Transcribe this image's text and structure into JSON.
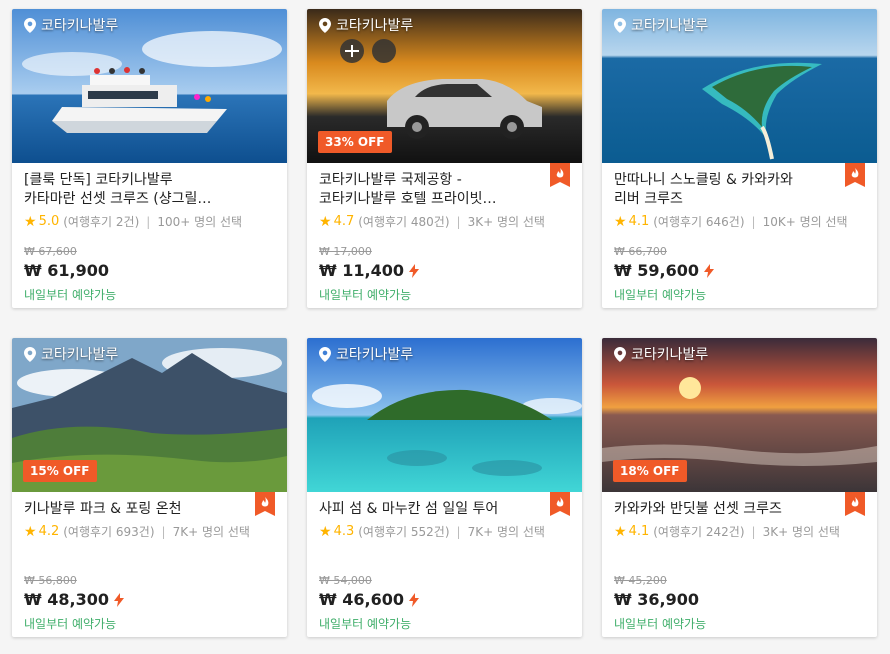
{
  "colors": {
    "discount": "#f05a28",
    "star": "#ffb400",
    "availability": "#3fae6a",
    "hot_badge": "#f05a28"
  },
  "icons": {
    "location": "map-pin-icon",
    "hot": "flame-icon",
    "instant": "lightning-icon",
    "rating": "star-icon"
  },
  "cards": [
    {
      "location": "코타키나발루",
      "title_line1": "[클룩 단독] 코타키나발루",
      "title_line2": "카타마란 선셋 크루즈 (샹그릴…",
      "rating": "5.0",
      "reviews": "(여행후기 2건)",
      "chosen": "100+ 명의 선택",
      "original_price": "₩ 67,600",
      "price": "₩ 61,900",
      "availability": "내일부터 예약가능",
      "discount": "",
      "hot": false,
      "instant": false
    },
    {
      "location": "코타키나발루",
      "title_line1": "코타키나발루 국제공항 -",
      "title_line2": "코타키나발루 호텔 프라이빗…",
      "rating": "4.7",
      "reviews": "(여행후기 480건)",
      "chosen": "3K+ 명의 선택",
      "original_price": "₩ 17,000",
      "price": "₩ 11,400",
      "availability": "내일부터 예약가능",
      "discount": "33% OFF",
      "hot": true,
      "instant": true
    },
    {
      "location": "코타키나발루",
      "title_line1": "만따나니 스노클링 & 카와카와",
      "title_line2": "리버 크루즈",
      "rating": "4.1",
      "reviews": "(여행후기 646건)",
      "chosen": "10K+ 명의 선택",
      "original_price": "₩ 66,700",
      "price": "₩ 59,600",
      "availability": "내일부터 예약가능",
      "discount": "",
      "hot": true,
      "instant": true
    },
    {
      "location": "코타키나발루",
      "title_line1": "키나발루 파크 & 포링 온천",
      "title_line2": "",
      "rating": "4.2",
      "reviews": "(여행후기 693건)",
      "chosen": "7K+ 명의 선택",
      "original_price": "₩ 56,800",
      "price": "₩ 48,300",
      "availability": "내일부터 예약가능",
      "discount": "15% OFF",
      "hot": true,
      "instant": true
    },
    {
      "location": "코타키나발루",
      "title_line1": "사피 섬 & 마누칸 섬 일일 투어",
      "title_line2": "",
      "rating": "4.3",
      "reviews": "(여행후기 552건)",
      "chosen": "7K+ 명의 선택",
      "original_price": "₩ 54,000",
      "price": "₩ 46,600",
      "availability": "내일부터 예약가능",
      "discount": "",
      "hot": true,
      "instant": true
    },
    {
      "location": "코타키나발루",
      "title_line1": "카와카와 반딧불 선셋 크루즈",
      "title_line2": "",
      "rating": "4.1",
      "reviews": "(여행후기 242건)",
      "chosen": "3K+ 명의 선택",
      "original_price": "₩ 45,200",
      "price": "₩ 36,900",
      "availability": "내일부터 예약가능",
      "discount": "18% OFF",
      "hot": true,
      "instant": false
    }
  ]
}
